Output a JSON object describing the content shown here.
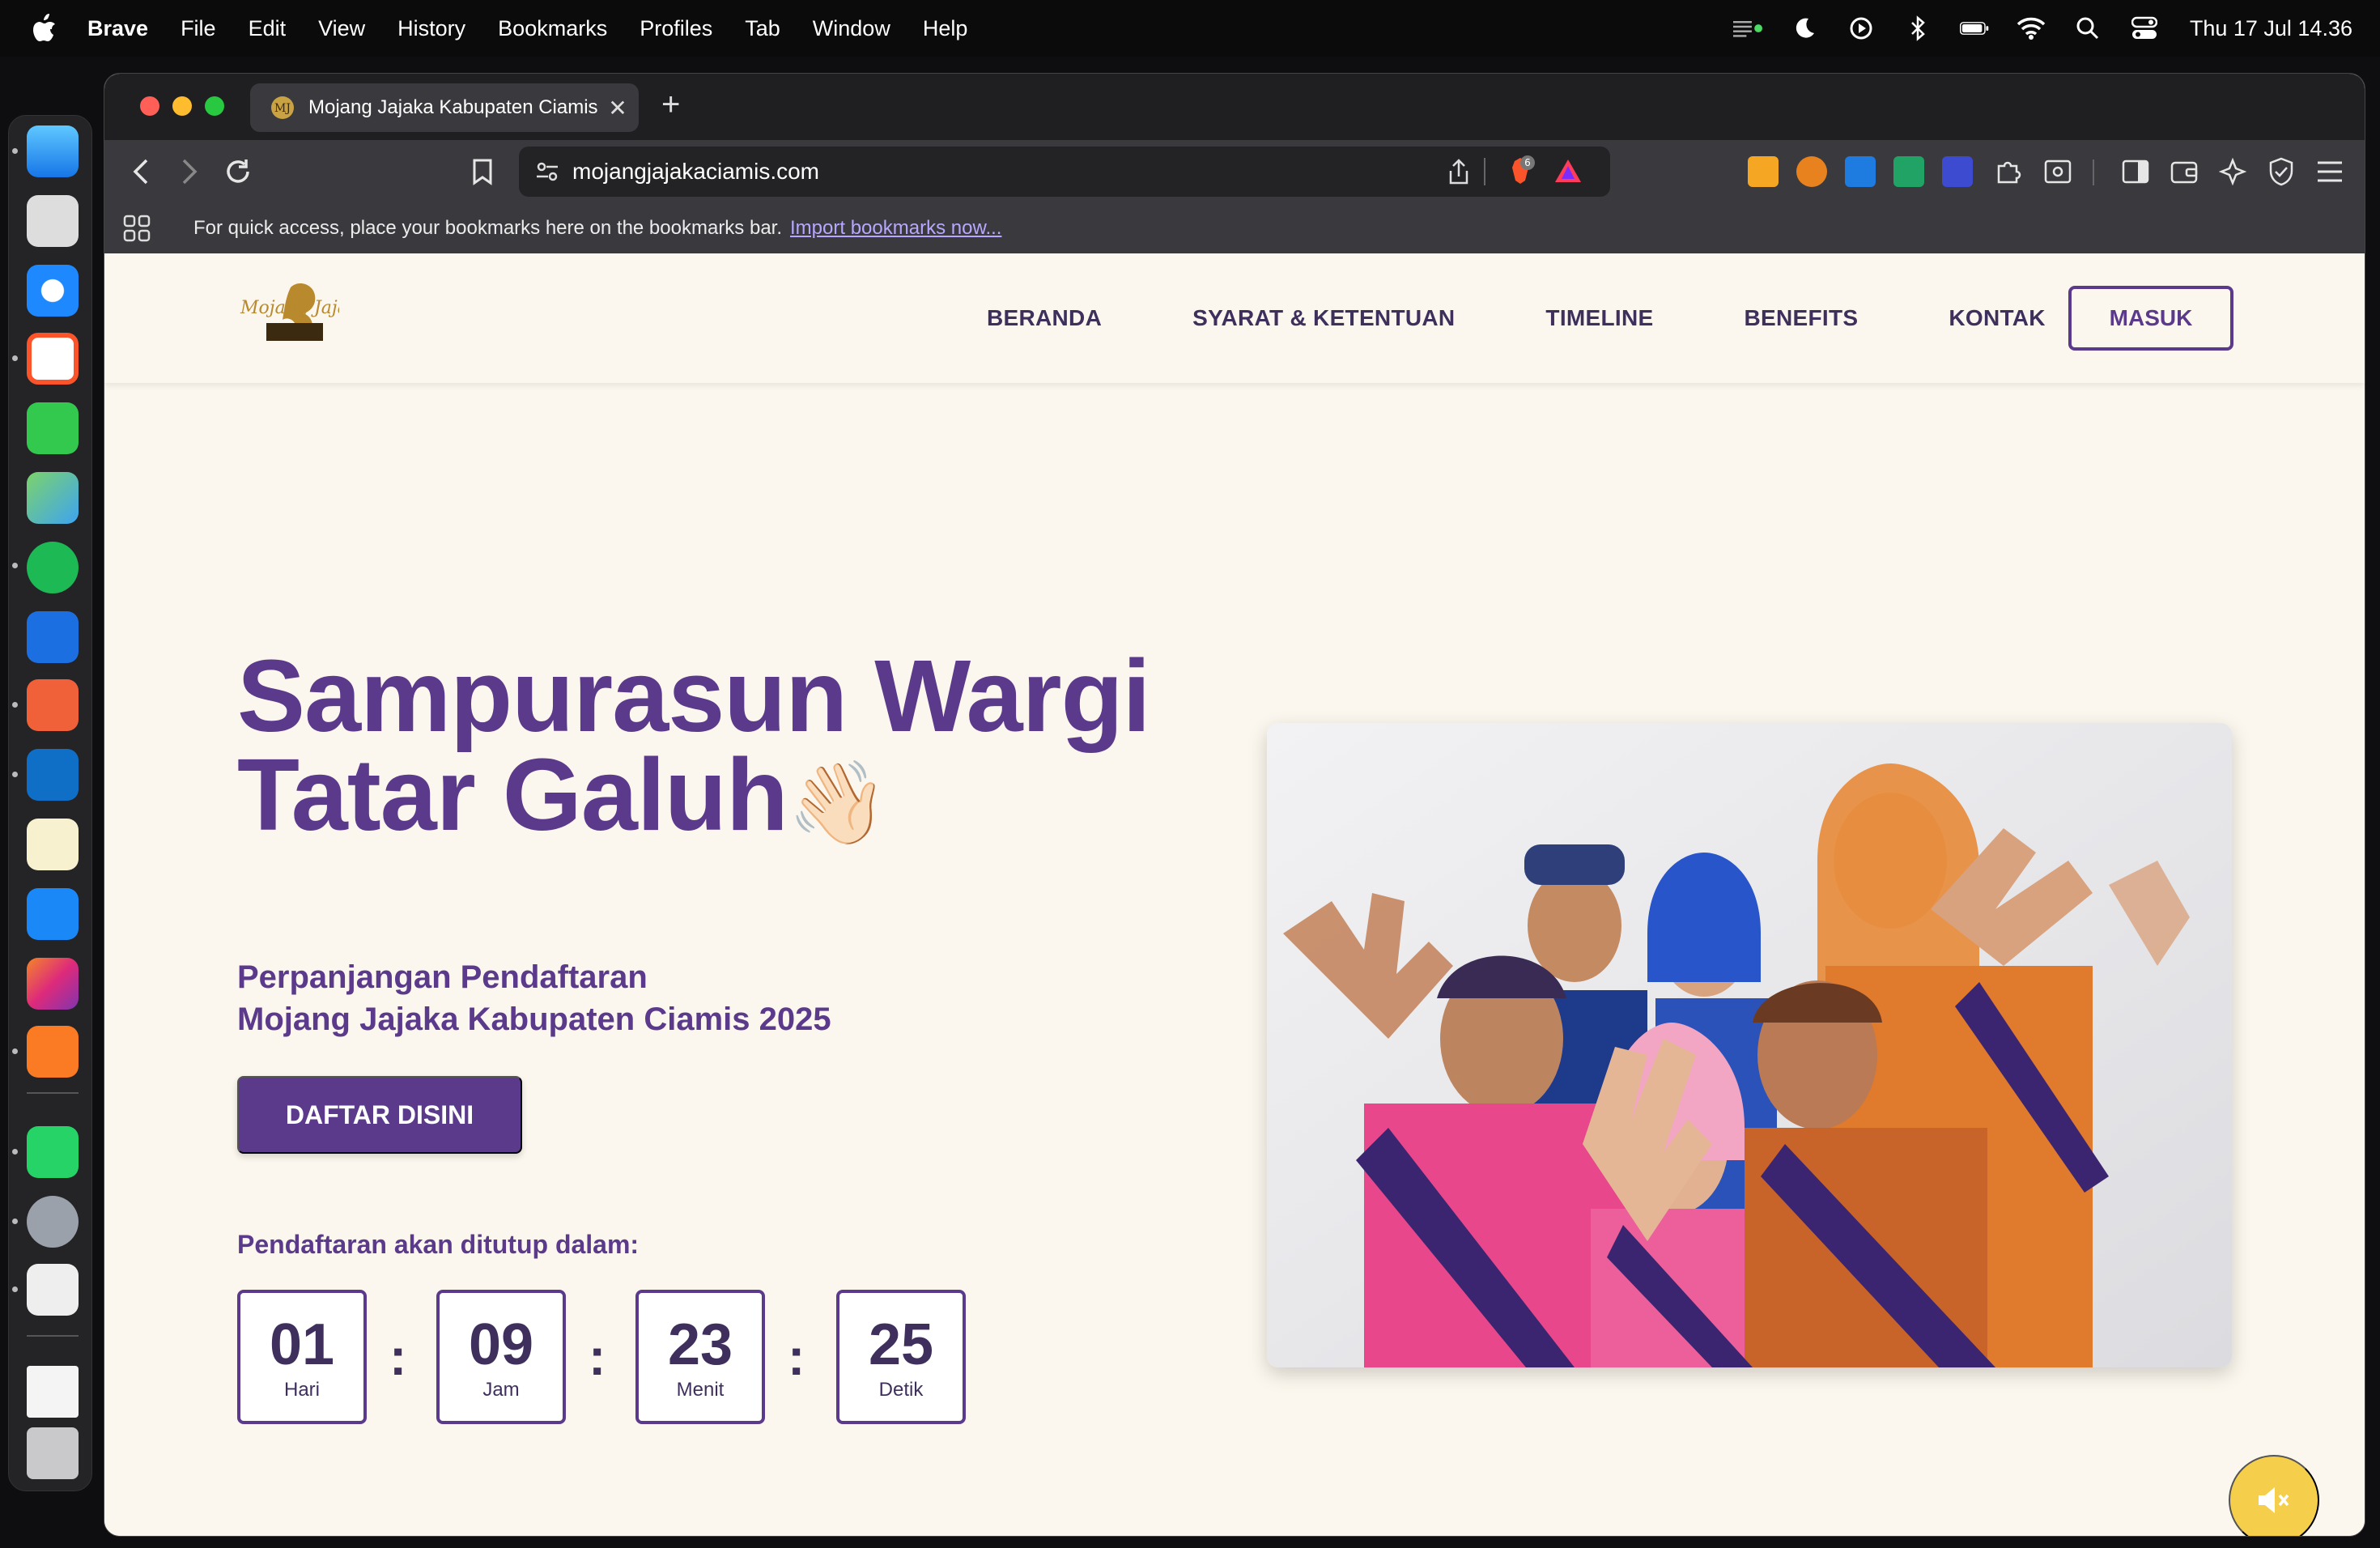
{
  "menubar": {
    "app": "Brave",
    "items": [
      "File",
      "Edit",
      "View",
      "History",
      "Bookmarks",
      "Profiles",
      "Tab",
      "Window",
      "Help"
    ],
    "clock": "Thu 17 Jul  14.36"
  },
  "browser": {
    "tab_title": "Mojang Jajaka Kabupaten Ciamis",
    "url": "mojangjajakaciamis.com",
    "shield_count": "6",
    "bookmarks_message": "For quick access, place your bookmarks here on the bookmarks bar.",
    "bookmarks_import": "Import bookmarks now..."
  },
  "site": {
    "logo_text": "Mojang Jajaka",
    "nav": [
      "BERANDA",
      "SYARAT & KETENTUAN",
      "TIMELINE",
      "BENEFITS",
      "KONTAK"
    ],
    "login_label": "MASUK",
    "hero_line1": "Sampurasun Wargi",
    "hero_line2": "Tatar Galuh",
    "hero_emoji": "👋🏻",
    "subtitle_line1": "Perpanjangan Pendaftaran",
    "subtitle_line2": "Mojang Jajaka Kabupaten Ciamis 2025",
    "cta_label": "DAFTAR DISINI",
    "countdown_label": "Pendaftaran akan ditutup dalam:",
    "countdown": [
      {
        "value": "01",
        "unit": "Hari"
      },
      {
        "value": "09",
        "unit": "Jam"
      },
      {
        "value": "23",
        "unit": "Menit"
      },
      {
        "value": "25",
        "unit": "Detik"
      }
    ],
    "separator": ":"
  },
  "colors": {
    "brand_purple": "#5b3a8c",
    "page_bg": "#fbf7ee",
    "mute_button": "#f5cf4c"
  },
  "icons": {
    "mute": "speaker-mute-icon"
  }
}
